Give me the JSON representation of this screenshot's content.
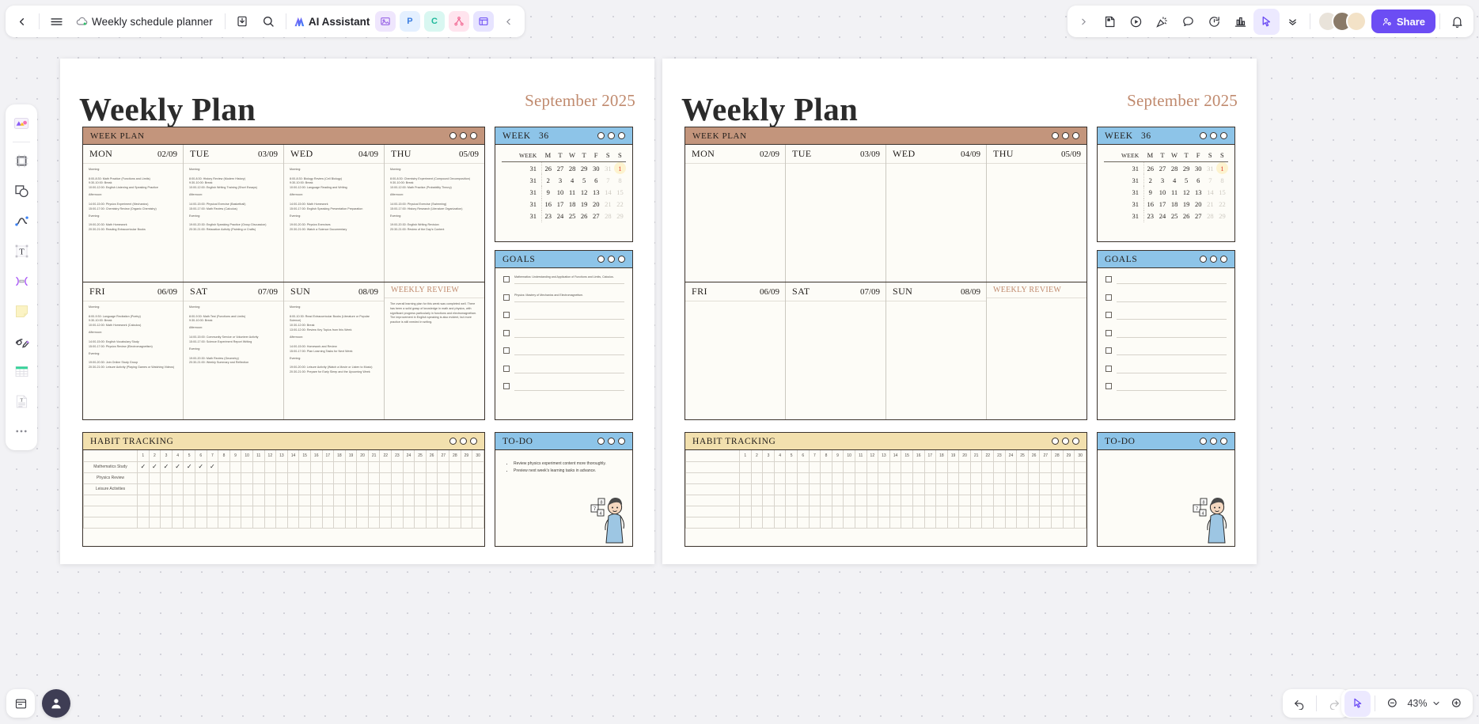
{
  "app": {
    "doc_title": "Weekly schedule planner",
    "ai_label": "AI Assistant",
    "share_label": "Share",
    "zoom_level": "43%",
    "chips": [
      {
        "name": "image-app",
        "label": ""
      },
      {
        "name": "presentation-app",
        "label": "P"
      },
      {
        "name": "code-app",
        "label": "C"
      },
      {
        "name": "mindmap-app",
        "label": ""
      },
      {
        "name": "mockup-app",
        "label": ""
      }
    ]
  },
  "tools": [
    {
      "name": "assets-tool"
    },
    {
      "name": "frame-tool"
    },
    {
      "name": "shape-tool"
    },
    {
      "name": "pen-tool"
    },
    {
      "name": "text-tool"
    },
    {
      "name": "connector-tool"
    },
    {
      "name": "sticky-note-tool"
    },
    {
      "name": "draw-tool"
    },
    {
      "name": "table-tool"
    },
    {
      "name": "document-tool"
    },
    {
      "name": "more-tools"
    }
  ],
  "page": {
    "title": "Weekly Plan",
    "month": "September 2025",
    "week_plan": {
      "header": "WEEK PLAN",
      "days": [
        {
          "day": "MON",
          "date": "02/09",
          "blocks": [
            {
              "label": "Morning:",
              "lines": [
                "8:00-8:30: Math Practice (Functions and Limits)",
                "9:30-10:00: Break",
                "10:00-12:00: English Listening and Speaking Practice"
              ]
            },
            {
              "label": "Afternoon:",
              "lines": [
                "14:00-15:00: Physics Experiment (Mechanics)",
                "15:00-17:00: Chemistry Review (Organic Chemistry)"
              ]
            },
            {
              "label": "Evening:",
              "lines": [
                "19:00-20:30: Math Homework",
                "20:30-21:00: Reading Extracurricular Books"
              ]
            }
          ]
        },
        {
          "day": "TUE",
          "date": "03/09",
          "blocks": [
            {
              "label": "Morning:",
              "lines": [
                "8:00-8:30: History Review (Modern History)",
                "9:30-10:00: Break",
                "10:00-12:00: English Writing Training (Short Essays)"
              ]
            },
            {
              "label": "Afternoon:",
              "lines": [
                "14:00-15:00: Physical Exercise (Basketball)",
                "15:00-17:00: Math Review (Calculus)"
              ]
            },
            {
              "label": "Evening:",
              "lines": [
                "19:00-20:30: English Speaking Practice (Group Discussion)",
                "20:30-21:00: Relaxation Activity (Painting or Crafts)"
              ]
            }
          ]
        },
        {
          "day": "WED",
          "date": "04/09",
          "blocks": [
            {
              "label": "Morning:",
              "lines": [
                "8:00-8:30: Biology Review (Cell Biology)",
                "9:30-10:00: Break",
                "10:00-12:00: Language Reading and Writing"
              ]
            },
            {
              "label": "Afternoon:",
              "lines": [
                "14:00-15:00: Math Homework",
                "15:00-17:00: English Speaking Presentation Preparation"
              ]
            },
            {
              "label": "Evening:",
              "lines": [
                "19:00-20:30: Physics Exercises",
                "20:30-21:00: Watch a Science Documentary"
              ]
            }
          ]
        },
        {
          "day": "THU",
          "date": "05/09",
          "blocks": [
            {
              "label": "Morning:",
              "lines": [
                "8:00-8:30: Chemistry Experiment (Compound Decomposition)",
                "9:30-10:00: Break",
                "10:00-12:00: Math Practice (Probability Theory)"
              ]
            },
            {
              "label": "Afternoon:",
              "lines": [
                "14:00-15:00: Physical Exercise (Swimming)",
                "15:00-17:00: History Research (Literature Organization)"
              ]
            },
            {
              "label": "Evening:",
              "lines": [
                "19:00-20:30: English Writing Revision",
                "20:30-21:00: Review of the Day's Content"
              ]
            }
          ]
        },
        {
          "day": "FRI",
          "date": "06/09",
          "blocks": [
            {
              "label": "Morning:",
              "lines": [
                "8:00-9:30: Language Recitation (Poetry)",
                "9:30-10:00: Break",
                "10:00-12:00: Math Homework (Calculus)"
              ]
            },
            {
              "label": "Afternoon:",
              "lines": [
                "14:00-15:00: English Vocabulary Study",
                "15:00-17:00: Physics Review (Electromagnetism)"
              ]
            },
            {
              "label": "Evening:",
              "lines": [
                "19:00-20:30: Join Online Study Group",
                "20:30-21:00: Leisure Activity (Playing Games or Watching Videos)"
              ]
            }
          ]
        },
        {
          "day": "SAT",
          "date": "07/09",
          "blocks": [
            {
              "label": "Morning:",
              "lines": [
                "8:00-9:30: Math Test (Functions and Limits)",
                "9:30-10:00: Break"
              ]
            },
            {
              "label": "Afternoon:",
              "lines": [
                "14:00-15:00: Community Service or Volunteer Activity",
                "15:00-17:00: Science Experiment Report Writing"
              ]
            },
            {
              "label": "Evening:",
              "lines": [
                "19:00-20:30: Math Review (Geometry)",
                "20:30-21:00: Weekly Summary and Reflection"
              ]
            }
          ]
        },
        {
          "day": "SUN",
          "date": "08/09",
          "blocks": [
            {
              "label": "Morning:",
              "lines": [
                "8:00-10:30: Read Extracurricular Books (Literature or Popular Science)",
                "10:30-12:00: Break",
                "13:00-12:00: Review Key Topics from this Week"
              ]
            },
            {
              "label": "Afternoon:",
              "lines": [
                "14:00-15:00: Homework and Review",
                "15:00-17:00: Plan Learning Tasks for Next Week"
              ]
            },
            {
              "label": "Evening:",
              "lines": [
                "19:00-20:00: Leisure Activity (Watch a Movie or Listen to Music)",
                "20:30-21:00: Prepare for Early Sleep and the Upcoming Week"
              ]
            }
          ]
        },
        {
          "day": "WEEKLY REVIEW",
          "date": "",
          "review": true,
          "blocks": [
            {
              "label": "",
              "lines": [
                "The overall learning plan for this week was completed well. There has been a solid grasp of knowledge in math and physics, with significant progress particularly in functions and electromagnetism. The improvement in English speaking is also evident, but more practice is still needed in writing."
              ]
            }
          ]
        }
      ]
    },
    "calendar": {
      "header_label": "WEEK",
      "header_value": "36",
      "columns": [
        "WEEK",
        "M",
        "T",
        "W",
        "T",
        "F",
        "S",
        "S"
      ],
      "rows": [
        {
          "week": "31",
          "days": [
            {
              "v": "26"
            },
            {
              "v": "27"
            },
            {
              "v": "28"
            },
            {
              "v": "29"
            },
            {
              "v": "30"
            },
            {
              "v": "31",
              "muted": true
            },
            {
              "v": "1",
              "today": true
            }
          ]
        },
        {
          "week": "31",
          "days": [
            {
              "v": "2"
            },
            {
              "v": "3"
            },
            {
              "v": "4"
            },
            {
              "v": "5"
            },
            {
              "v": "6"
            },
            {
              "v": "7",
              "muted": true
            },
            {
              "v": "8",
              "muted": true
            }
          ]
        },
        {
          "week": "31",
          "days": [
            {
              "v": "9"
            },
            {
              "v": "10"
            },
            {
              "v": "11"
            },
            {
              "v": "12"
            },
            {
              "v": "13"
            },
            {
              "v": "14",
              "muted": true
            },
            {
              "v": "15",
              "muted": true
            }
          ]
        },
        {
          "week": "31",
          "days": [
            {
              "v": "16"
            },
            {
              "v": "17"
            },
            {
              "v": "18"
            },
            {
              "v": "19"
            },
            {
              "v": "20"
            },
            {
              "v": "21",
              "muted": true
            },
            {
              "v": "22",
              "muted": true
            }
          ]
        },
        {
          "week": "31",
          "days": [
            {
              "v": "23"
            },
            {
              "v": "24"
            },
            {
              "v": "25"
            },
            {
              "v": "26"
            },
            {
              "v": "27"
            },
            {
              "v": "28",
              "muted": true
            },
            {
              "v": "29",
              "muted": true
            }
          ]
        }
      ]
    },
    "goals": {
      "header": "GOALS",
      "items": [
        "Mathematics: Understanding and Application of Functions and Limits, Calculus.",
        "Physics: Mastery of Mechanics and Electromagnetism.",
        "",
        "",
        "",
        "",
        ""
      ]
    },
    "habit_tracking": {
      "header": "HABIT TRACKING",
      "day_columns": [
        "1",
        "2",
        "3",
        "4",
        "5",
        "6",
        "7",
        "8",
        "9",
        "10",
        "11",
        "12",
        "13",
        "14",
        "15",
        "16",
        "17",
        "18",
        "19",
        "20",
        "21",
        "22",
        "23",
        "24",
        "25",
        "26",
        "27",
        "28",
        "29",
        "30"
      ],
      "rows": [
        {
          "label": "Mathematics Study",
          "checked": [
            1,
            2,
            3,
            4,
            5,
            6,
            7
          ]
        },
        {
          "label": "Physics Review",
          "checked": []
        },
        {
          "label": "Leisure Activities",
          "checked": []
        },
        {
          "label": "",
          "checked": []
        },
        {
          "label": "",
          "checked": []
        },
        {
          "label": "",
          "checked": []
        }
      ]
    },
    "todo": {
      "header": "TO-DO",
      "items": [
        "Review physics experiment content more thoroughly.",
        "Preview next week's learning tasks in advance."
      ]
    }
  },
  "page2": {
    "goals_items": [
      "",
      "",
      "",
      "",
      "",
      "",
      ""
    ],
    "todo_items": [],
    "week_plan_empty": true
  },
  "colors": {
    "accent": "#6c4df4",
    "header_brown": "#c3957c",
    "header_blue": "#8dc4e8",
    "header_cream": "#f2e0ae",
    "month_text": "#c08a6e",
    "today_red": "#e03a2f"
  }
}
